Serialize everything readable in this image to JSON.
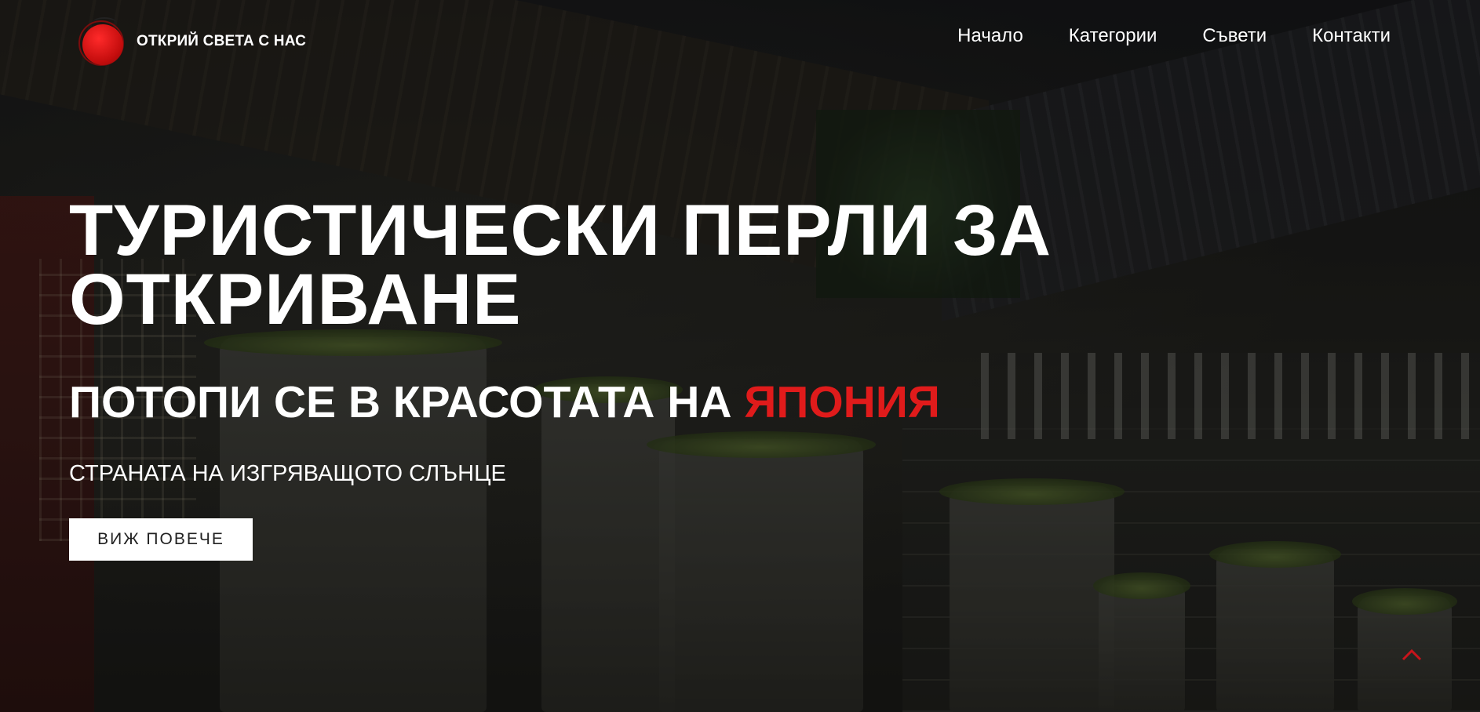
{
  "header": {
    "logo_text": "ОТКРИЙ СВЕТА С НАС",
    "nav": [
      {
        "label": "Начало"
      },
      {
        "label": "Категории"
      },
      {
        "label": "Съвети"
      },
      {
        "label": "Контакти"
      }
    ]
  },
  "hero": {
    "title": "ТУРИСТИЧЕСКИ ПЕРЛИ ЗА ОТКРИВАНЕ",
    "subtitle_prefix": "ПОТОПИ СЕ В КРАСОТАТА НА ",
    "subtitle_accent": "ЯПОНИЯ",
    "tagline": "СТРАНАТА НА ИЗГРЯВАЩОТО СЛЪНЦЕ",
    "cta_label": "ВИЖ ПОВЕЧЕ"
  },
  "icons": {
    "logo": "red-sun-logo-icon",
    "scroll_top": "chevron-up-icon"
  },
  "colors": {
    "accent": "#e01b1b",
    "text": "#ffffff",
    "button_bg": "#ffffff",
    "button_text": "#222222"
  }
}
